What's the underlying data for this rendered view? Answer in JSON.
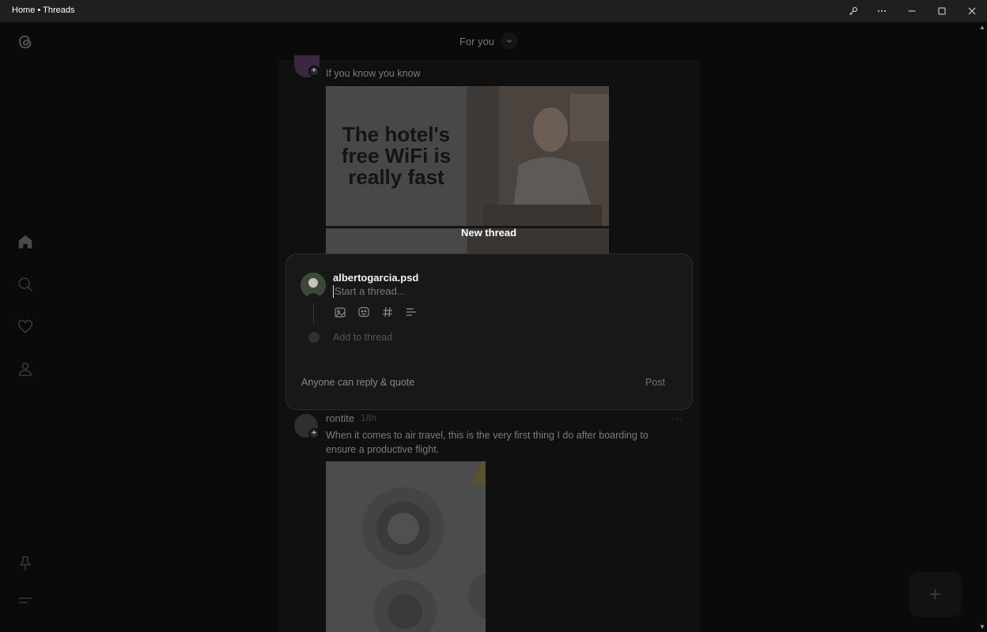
{
  "window": {
    "title": "Home • Threads",
    "controls": {
      "settings_icon": "key-icon",
      "more_icon": "ellipsis-icon",
      "minimize_icon": "minimize-icon",
      "maximize_icon": "maximize-icon",
      "close_icon": "close-icon"
    }
  },
  "sidebar": {
    "logo": "threads-logo",
    "items": [
      {
        "name": "home",
        "icon": "home-icon"
      },
      {
        "name": "search",
        "icon": "search-icon"
      },
      {
        "name": "activity",
        "icon": "heart-icon"
      },
      {
        "name": "profile",
        "icon": "user-icon"
      }
    ],
    "bottom": [
      {
        "name": "pin",
        "icon": "pin-icon"
      },
      {
        "name": "menu",
        "icon": "menu-icon"
      }
    ]
  },
  "feed": {
    "header": {
      "label": "For you"
    },
    "posts": [
      {
        "text": "If you know you know",
        "image_text": "The hotel's free WiFi is really fast"
      },
      {
        "author": "rontite",
        "time": "18h",
        "more": "···",
        "text": "When it comes to air travel, this is the very first thing I do after boarding to ensure a productive flight."
      }
    ]
  },
  "composer": {
    "heading": "New thread",
    "username": "albertogarcia.psd",
    "placeholder": "Start a thread...",
    "tools": [
      "image-icon",
      "gif-icon",
      "hashtag-icon",
      "poll-icon"
    ],
    "add_to_thread": "Add to thread",
    "reply_setting": "Anyone can reply & quote",
    "post_label": "Post"
  },
  "fab": {
    "label": "+"
  },
  "colors": {
    "background": "#0a0a0a",
    "feed": "#101010",
    "modal": "#181818",
    "text_primary": "#f3f5f7",
    "text_muted": "#7a7a7a"
  }
}
